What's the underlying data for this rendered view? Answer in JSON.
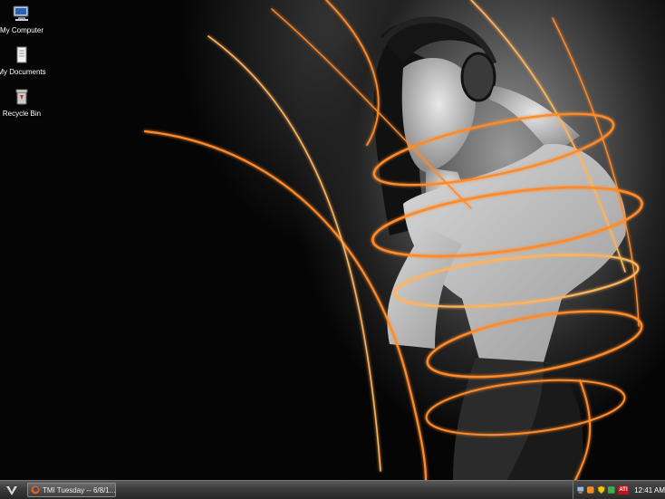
{
  "desktop": {
    "icons": [
      {
        "label": "My Computer",
        "icon": "computer-icon"
      },
      {
        "label": "My Documents",
        "icon": "documents-icon"
      },
      {
        "label": "Recycle Bin",
        "icon": "recycle-bin-icon"
      }
    ]
  },
  "taskbar": {
    "start_icon": "start-v-logo-icon",
    "task_button_label": "TMI Tuesday -- 6/8/1...",
    "task_button_icon": "firefox-icon",
    "tray_icons": [
      "network-icon",
      "security-shield-icon",
      "ati-icon"
    ],
    "ati_label": "ATI",
    "clock": "12:41 AM"
  },
  "colors": {
    "accent": "#ff8a2a",
    "taskbar": "#3b3b3b"
  }
}
